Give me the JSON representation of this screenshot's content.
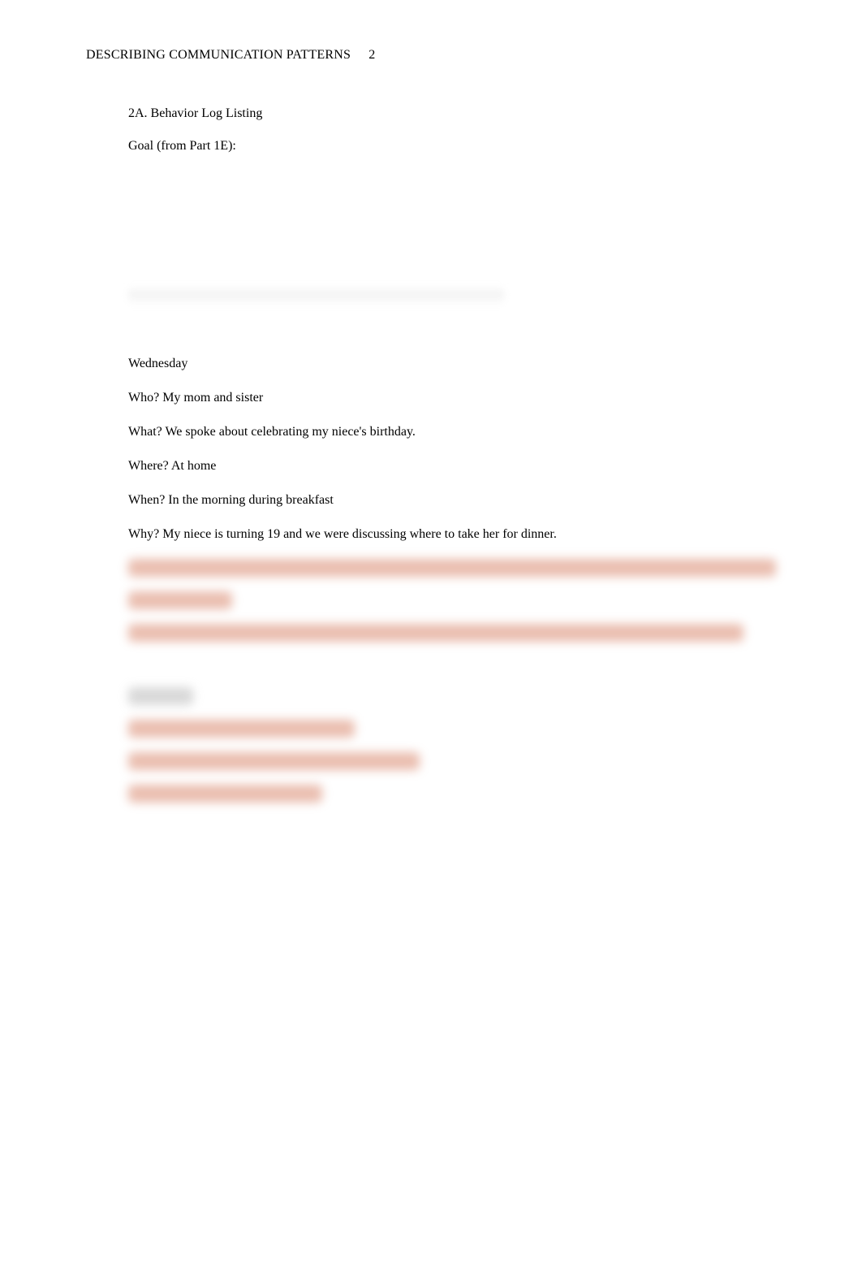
{
  "header": {
    "running_head": "DESCRIBING COMMUNICATION PATTERNS",
    "page_number": "2"
  },
  "section": {
    "number_title": "2A. Behavior Log Listing",
    "goal_label": "Goal (from Part 1E):"
  },
  "entries": {
    "wednesday": {
      "day": "Wednesday",
      "who": "Who? My mom and sister",
      "what": "What? We spoke about celebrating my niece's birthday.",
      "where": "Where? At home",
      "when": "When? In the morning during breakfast",
      "why": "Why? My niece is turning 19 and we were discussing where to take her for dinner."
    }
  }
}
